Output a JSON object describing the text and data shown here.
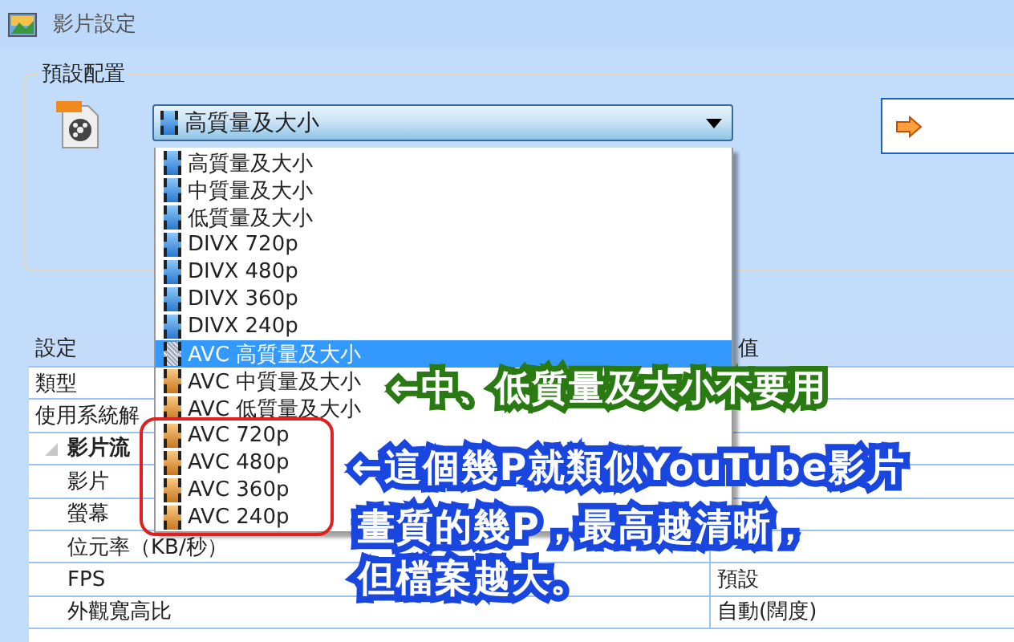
{
  "window": {
    "title": "影片設定"
  },
  "preset": {
    "legend": "預設配置",
    "combo_value": "高質量及大小"
  },
  "dropdown": [
    {
      "label": "高質量及大小",
      "kind": "blue",
      "selected": false
    },
    {
      "label": "中質量及大小",
      "kind": "blue",
      "selected": false
    },
    {
      "label": "低質量及大小",
      "kind": "blue",
      "selected": false
    },
    {
      "label": "DIVX 720p",
      "kind": "blue",
      "selected": false
    },
    {
      "label": "DIVX 480p",
      "kind": "blue",
      "selected": false
    },
    {
      "label": "DIVX 360p",
      "kind": "blue",
      "selected": false
    },
    {
      "label": "DIVX 240p",
      "kind": "blue",
      "selected": false
    },
    {
      "label": "AVC 高質量及大小",
      "kind": "orange",
      "selected": true
    },
    {
      "label": "AVC 中質量及大小",
      "kind": "orange",
      "selected": false
    },
    {
      "label": "AVC 低質量及大小",
      "kind": "orange",
      "selected": false
    },
    {
      "label": "AVC 720p",
      "kind": "orange",
      "selected": false
    },
    {
      "label": "AVC 480p",
      "kind": "orange",
      "selected": false
    },
    {
      "label": "AVC 360p",
      "kind": "orange",
      "selected": false
    },
    {
      "label": "AVC 240p",
      "kind": "orange",
      "selected": false
    }
  ],
  "table": {
    "columns": [
      "設定",
      "值"
    ],
    "rows": [
      {
        "setting": "類型"
      },
      {
        "setting": "使用系統解"
      },
      {
        "setting": "影片流",
        "kind": "group",
        "expanded": true,
        "children": [
          {
            "setting": "影片"
          },
          {
            "setting": "螢幕"
          },
          {
            "setting": "位元率（KB/秒）"
          },
          {
            "setting": "FPS",
            "value": "預設"
          },
          {
            "setting": "外觀寬高比",
            "value": "自動(闊度)"
          }
        ]
      }
    ]
  },
  "annotations": [
    {
      "text": "←中、低質量及大小不要用",
      "kind": "green"
    },
    {
      "text": "←這個幾P就類似YouTube影片",
      "kind": "blue"
    },
    {
      "text": "畫質的幾P，最高越清晰，",
      "kind": "blue"
    },
    {
      "text": "但檔案越大。",
      "kind": "blue"
    }
  ]
}
